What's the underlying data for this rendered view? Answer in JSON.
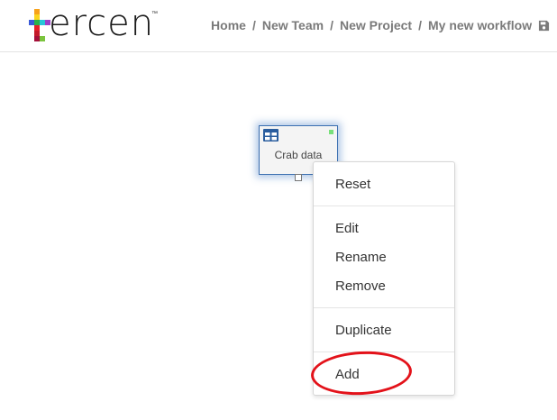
{
  "header": {
    "logo": {
      "text": "ercen",
      "tm": "™"
    },
    "breadcrumb": {
      "items": [
        "Home",
        "New Team",
        "New Project",
        "My new workflow"
      ],
      "separator": "/"
    },
    "icons": {
      "save": "save-icon"
    }
  },
  "workflow": {
    "node": {
      "label": "Crab data",
      "icon": "table-icon",
      "status_color": "#78e07a",
      "border_color": "#3b6fb0"
    }
  },
  "context_menu": {
    "groups": [
      [
        "Reset"
      ],
      [
        "Edit",
        "Rename",
        "Remove"
      ],
      [
        "Duplicate"
      ],
      [
        "Add"
      ]
    ]
  },
  "colors": {
    "annotation": "#e3121a",
    "breadcrumb": "#7a7a7a",
    "node_icon": "#2a5d9e"
  }
}
